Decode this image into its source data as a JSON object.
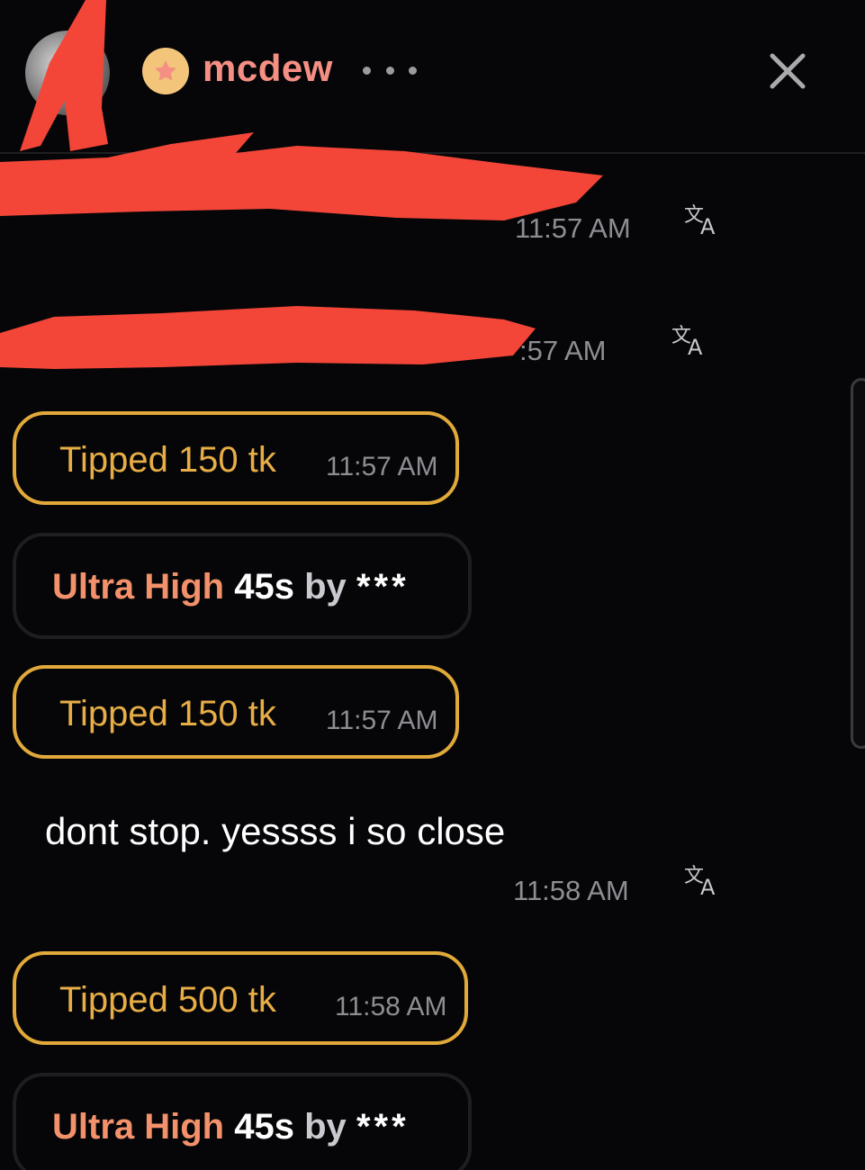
{
  "header": {
    "username": "mcdew",
    "colors": {
      "username": "#f58f84",
      "badge": "#f2c57a"
    }
  },
  "messages": {
    "redacted_1_time": "11:57 AM",
    "redacted_2_time": ":57 AM",
    "tip_1": {
      "text": "Tipped 150 tk",
      "time": "11:57 AM"
    },
    "ultra_1": {
      "level": "Ultra High",
      "duration": "45s",
      "by": "by",
      "user": "***"
    },
    "tip_2": {
      "text": "Tipped 150 tk",
      "time": "11:57 AM"
    },
    "chat_1": {
      "text": "dont stop. yessss i so close",
      "time": "11:58 AM"
    },
    "tip_3": {
      "text": "Tipped 500 tk",
      "time": "11:58 AM"
    },
    "ultra_2": {
      "level": "Ultra High",
      "duration": "45s",
      "by": "by",
      "user": "***"
    }
  },
  "icons": [
    "star-badge-icon",
    "more-options-icon",
    "close-icon",
    "translate-icon"
  ],
  "colors": {
    "tip_border": "#e1a93a",
    "tip_text": "#e7ad46",
    "ultra_level": "#f2916a",
    "redaction": "#f34638"
  }
}
